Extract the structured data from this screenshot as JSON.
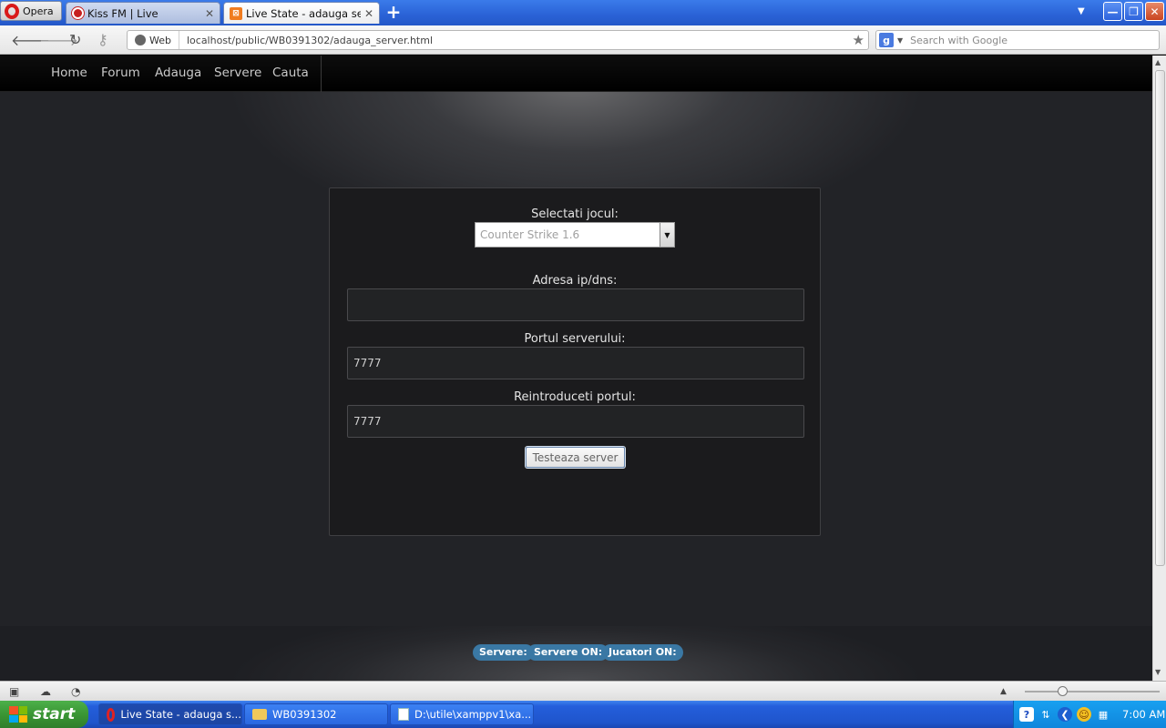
{
  "browser": {
    "menu_label": "Opera",
    "tabs": [
      {
        "title": "Kiss FM | Live",
        "active": false
      },
      {
        "title": "Live State - adauga server",
        "active": true
      }
    ],
    "close_glyph": "✕",
    "new_tab_glyph": "+",
    "address": {
      "badge": "Web",
      "url": "localhost/public/WB0391302/adauga_server.html"
    },
    "search": {
      "placeholder": "Search with Google"
    }
  },
  "site": {
    "nav": [
      "Home",
      "Forum",
      "Adauga",
      "Servere",
      "Cauta"
    ],
    "form": {
      "game_label": "Selectati jocul:",
      "game_value": "Counter Strike 1.6",
      "ip_label": "Adresa ip/dns:",
      "ip_value": "",
      "port_label": "Portul serverului:",
      "port_value": "7777",
      "port_repeat_label": "Reintroduceti portul:",
      "port_repeat_value": "7777",
      "submit_label": "Testeaza server"
    },
    "footer": {
      "servers_label": "Servere:",
      "servers_on_label": "Servere ON:",
      "players_on_label": "Jucatori ON:"
    }
  },
  "taskbar": {
    "start_label": "start",
    "items": [
      {
        "label": "Live State - adauga s...",
        "active": true
      },
      {
        "label": "WB0391302",
        "active": false
      },
      {
        "label": "D:\\utile\\xamppv1\\xa...",
        "active": false
      }
    ],
    "clock": "7:00 AM"
  },
  "colors": {
    "accent_badge": "#3a78a4",
    "taskbar_blue": "#245edb",
    "start_green": "#3a9634"
  }
}
